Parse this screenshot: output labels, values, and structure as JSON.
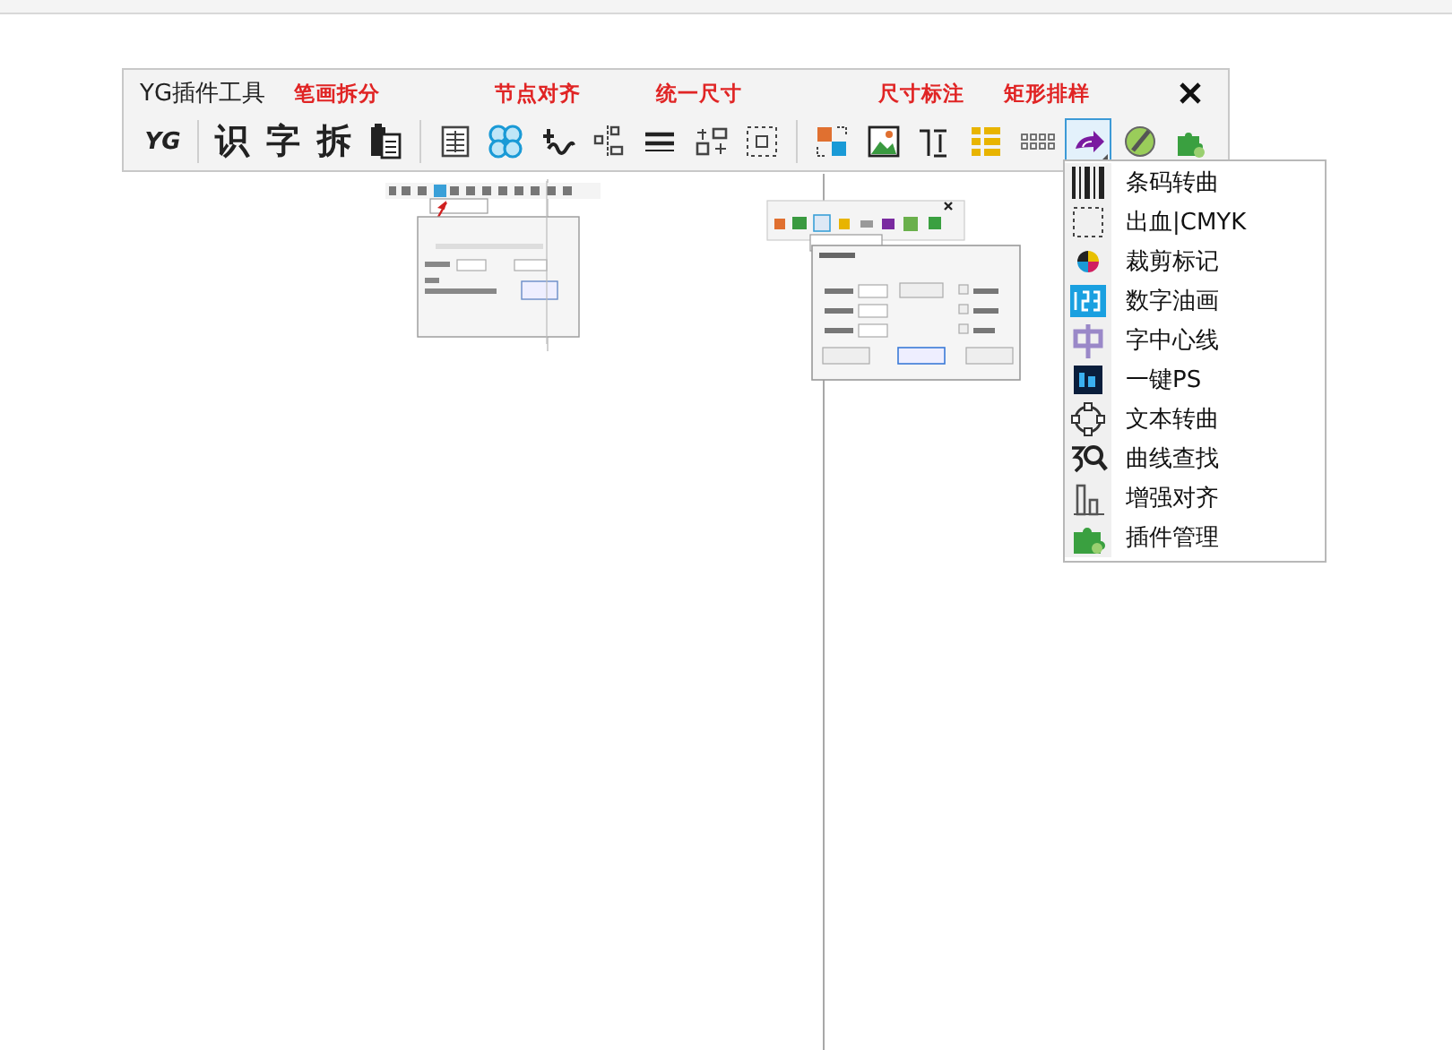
{
  "toolbar": {
    "title": "YG插件工具",
    "group_labels": [
      "笔画拆分",
      "节点对齐",
      "统一尺寸",
      "尺寸标注",
      "矩形排样"
    ],
    "tools": [
      {
        "kind": "glyph",
        "text": "YG",
        "selected": false
      },
      {
        "kind": "separator"
      },
      {
        "kind": "glyph",
        "text": "识",
        "selected": false
      },
      {
        "kind": "glyph",
        "text": "字",
        "selected": false
      },
      {
        "kind": "glyph",
        "text": "拆",
        "selected": false
      },
      {
        "kind": "icon",
        "selected": false
      },
      {
        "kind": "separator"
      },
      {
        "kind": "icon",
        "selected": false
      },
      {
        "kind": "icon",
        "selected": false
      },
      {
        "kind": "icon",
        "selected": false
      },
      {
        "kind": "icon",
        "selected": false
      },
      {
        "kind": "icon",
        "selected": false
      },
      {
        "kind": "icon",
        "selected": false
      },
      {
        "kind": "icon",
        "selected": false
      },
      {
        "kind": "separator"
      },
      {
        "kind": "icon",
        "selected": false
      },
      {
        "kind": "icon",
        "selected": false
      },
      {
        "kind": "icon",
        "selected": false
      },
      {
        "kind": "icon",
        "selected": false
      },
      {
        "kind": "icon",
        "selected": false
      },
      {
        "kind": "icon",
        "selected": true
      },
      {
        "kind": "icon",
        "selected": false
      },
      {
        "kind": "icon",
        "selected": false
      }
    ]
  },
  "dropdown_menu": {
    "items": [
      {
        "label": "条码转曲"
      },
      {
        "label": "出血|CMYK"
      },
      {
        "label": "裁剪标记"
      },
      {
        "label": "数字油画"
      },
      {
        "label": "字中心线"
      },
      {
        "label": "一键PS"
      },
      {
        "label": "文本转曲"
      },
      {
        "label": "曲线查找"
      },
      {
        "label": "增强对齐"
      },
      {
        "label": "插件管理"
      }
    ]
  }
}
